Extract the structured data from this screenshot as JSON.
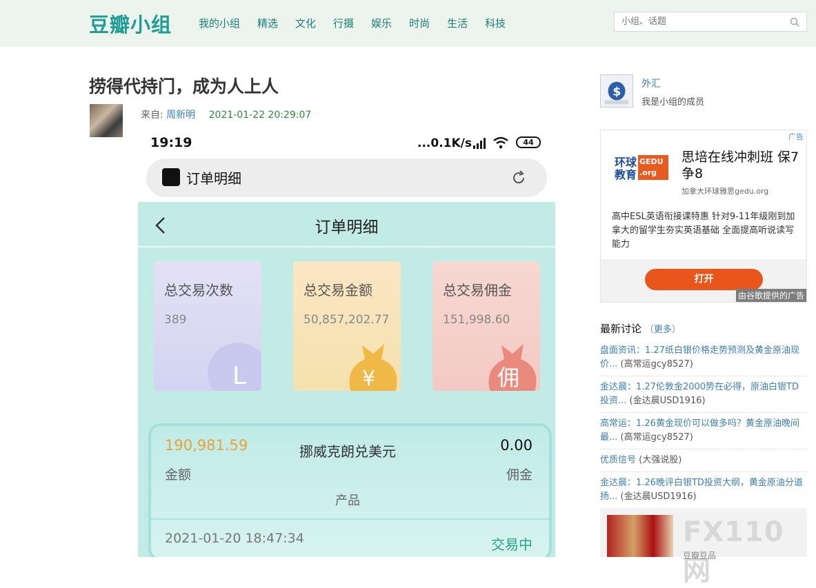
{
  "header": {
    "logo": "豆瓣小组",
    "nav": [
      "我的小组",
      "精选",
      "文化",
      "行摄",
      "娱乐",
      "时尚",
      "生活",
      "科技"
    ],
    "search_placeholder": "小组、话题"
  },
  "post": {
    "title": "捞得代持门，成为人上人",
    "from_label": "来自:",
    "author": "周新明",
    "time": "2021-01-22 20:29:07"
  },
  "phone": {
    "clock": "19:19",
    "network": "...0.1K/s",
    "battery": "44",
    "tab_title": "订单明细",
    "page_title": "订单明细",
    "cards": [
      {
        "label": "总交易次数",
        "value": "389",
        "icon": "L"
      },
      {
        "label": "总交易金额",
        "value": "50,857,202.77",
        "icon": "¥"
      },
      {
        "label": "总交易佣金",
        "value": "151,998.60",
        "icon": "佣"
      }
    ],
    "order": {
      "amount": "190,981.59",
      "amount_label": "金额",
      "product": "挪威克朗兑美元",
      "product_label": "产品",
      "fee": "0.00",
      "fee_label": "佣金",
      "datetime": "2021-01-20 18:47:34",
      "status": "交易中"
    }
  },
  "sidebar": {
    "group_name": "外汇",
    "group_member": "我是小组的成员",
    "ad": {
      "tag": "广告",
      "logo_text_1": "环球",
      "logo_text_2": "教育",
      "logo_badge": "GEDU .org",
      "headline": "思培在线冲刺班 保7争8",
      "sub": "加拿大环球雅思gedu.org",
      "body": "高中ESL英语衔接课特惠 针对9-11年级刚到加拿大的留学生夯实英语基础 全面提高听说读写能力",
      "button": "打开",
      "google": "由谷歌提供的广告"
    },
    "latest": {
      "title": "最新讨论",
      "more": "更多",
      "items": [
        {
          "text": "盘面资讯：1.27纸白银价格走势预测及黄金原油现价...",
          "author": "(高常运gcy8527)"
        },
        {
          "text": "金达晨：1.27伦敦金2000势在必得，原油白银TD投资...",
          "author": "(金达晨USD1916)"
        },
        {
          "text": "高常运：1.26黄金现价可以做多吗？黄金原油晚间最...",
          "author": "(高常运gcy8527)"
        },
        {
          "text": "优质信号",
          "author": "(大强说股)"
        },
        {
          "text": "金达晨：1.26晚评白银TD投资大纲，黄金原油分道扬...",
          "author": "(金达晨USD1916)"
        }
      ]
    },
    "watermark": "FX110网",
    "thumb_label": "豆瓣豆品"
  }
}
